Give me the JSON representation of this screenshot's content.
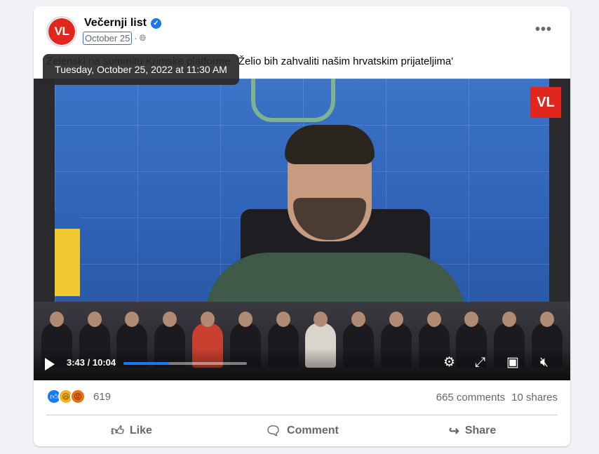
{
  "post": {
    "page_name": "Večernji list",
    "avatar_text": "VL",
    "date": "October 25",
    "separator": "·",
    "caption": "Zelenski na summitu Krimske platforme: 'Želio bih zahvaliti našim hrvatskim prijateljima'",
    "tooltip": "Tuesday, October 25, 2022 at 11:30 AM",
    "more_label": "•••"
  },
  "video": {
    "badge": "VL",
    "time": "3:43 / 10:04",
    "progress": 0.37
  },
  "stats": {
    "reaction_count": "619",
    "comments": "665 comments",
    "shares": "10 shares"
  },
  "actions": {
    "like": "Like",
    "comment": "Comment",
    "share": "Share"
  },
  "icons": {
    "verified": "verified-badge-icon",
    "globe": "globe-icon",
    "play": "play-icon",
    "settings": "gear-icon",
    "fullscreen": "fullscreen-icon",
    "pip": "picture-in-picture-icon",
    "mute": "volume-muted-icon"
  },
  "colors": {
    "brand_red": "#e1271d",
    "facebook_blue": "#1877f2"
  }
}
